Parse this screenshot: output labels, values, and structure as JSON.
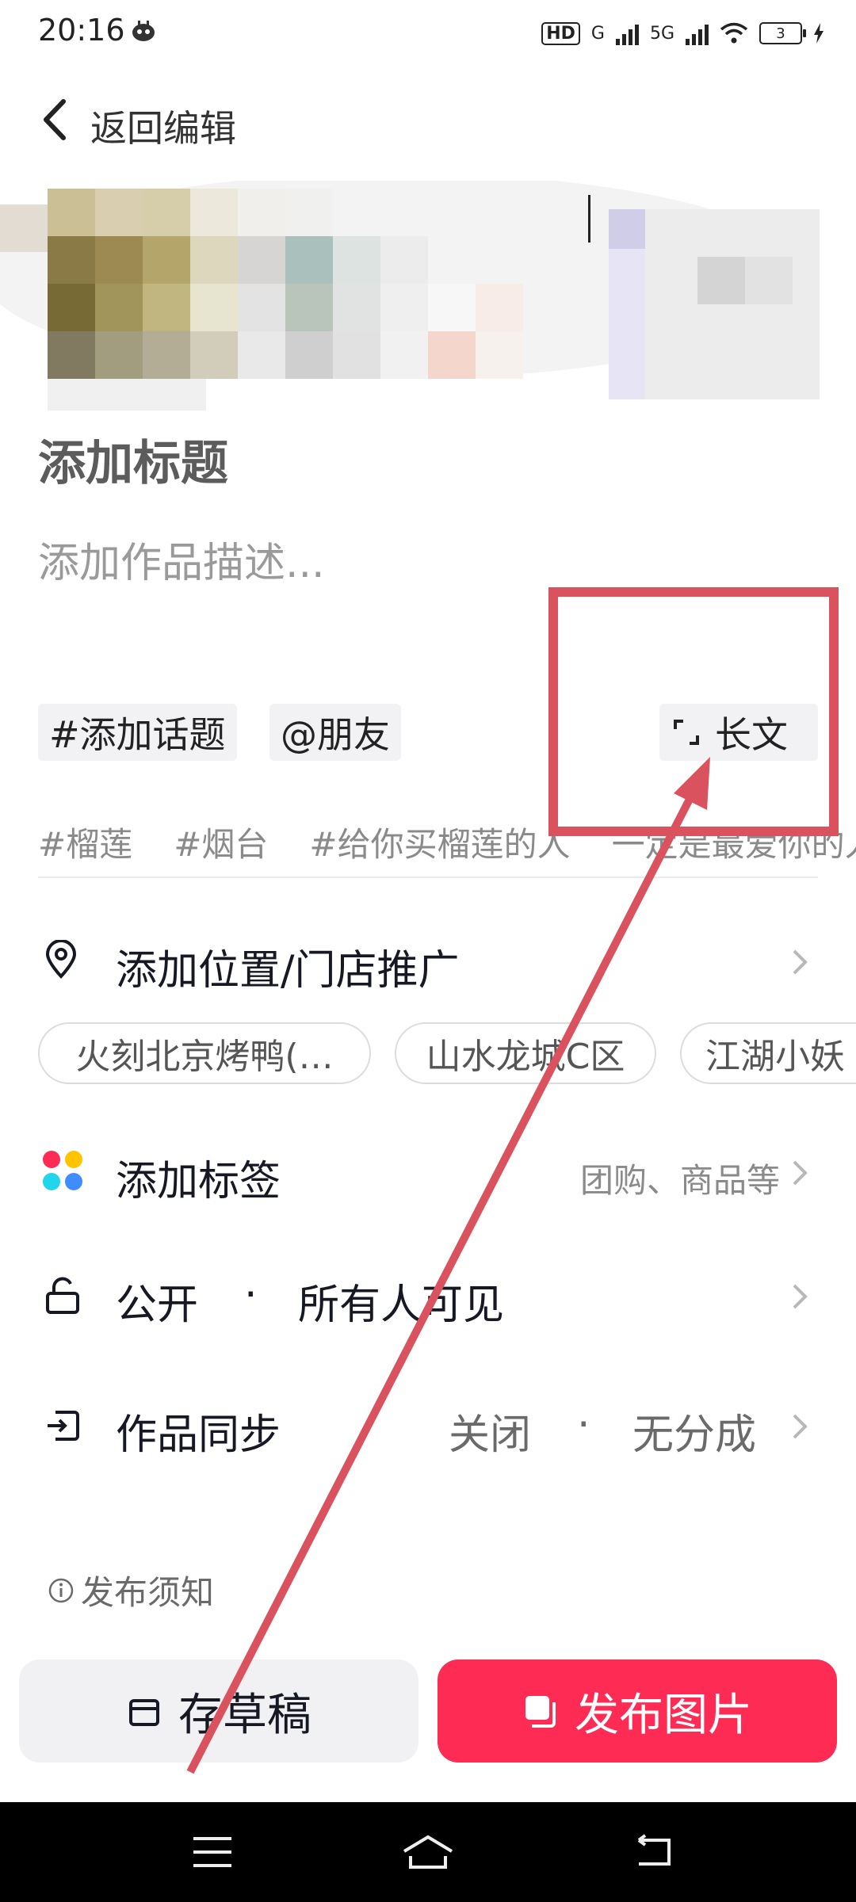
{
  "status_bar": {
    "time": "20:16",
    "network_hd": "HD",
    "network_g": "G",
    "network_5g": "5G",
    "battery": "3"
  },
  "header": {
    "back_label": "返回编辑"
  },
  "post": {
    "title_placeholder": "添加标题",
    "desc_placeholder": "添加作品描述..."
  },
  "chips": {
    "topic": "#添加话题",
    "friend": "@朋友",
    "long_text": "长文"
  },
  "suggested_tags": [
    "#榴莲",
    "#烟台",
    "#给你买榴莲的人",
    "一定是最爱你的人"
  ],
  "location": {
    "label": "添加位置/门店推广",
    "suggestions": [
      "火刻北京烤鸭(…",
      "山水龙城C区",
      "江湖小妖"
    ]
  },
  "label_row": {
    "label": "添加标签",
    "value": "团购、商品等"
  },
  "visibility_row": {
    "label": "公开",
    "separator": "·",
    "value": "所有人可见"
  },
  "sync_row": {
    "label": "作品同步",
    "value_a": "关闭",
    "separator": "·",
    "value_b": "无分成"
  },
  "notice": "发布须知",
  "buttons": {
    "draft": "存草稿",
    "publish": "发布图片"
  },
  "colors": {
    "accent": "#fe2c55",
    "annotation": "#d9525e",
    "dot_red": "#fe2c55",
    "dot_yellow": "#ffc300",
    "dot_cyan": "#20d5ec",
    "dot_blue": "#3f8cff"
  },
  "icons": {
    "back": "chevron-left-icon",
    "long_text": "expand-corners-icon",
    "location": "map-pin-icon",
    "labels": "four-dots-icon",
    "visibility": "unlock-icon",
    "sync": "sync-export-icon",
    "notice": "info-icon",
    "draft": "draft-box-icon",
    "publish": "images-icon",
    "nav_menu": "menu-icon",
    "nav_home": "home-icon",
    "nav_back": "back-arrow-icon"
  }
}
